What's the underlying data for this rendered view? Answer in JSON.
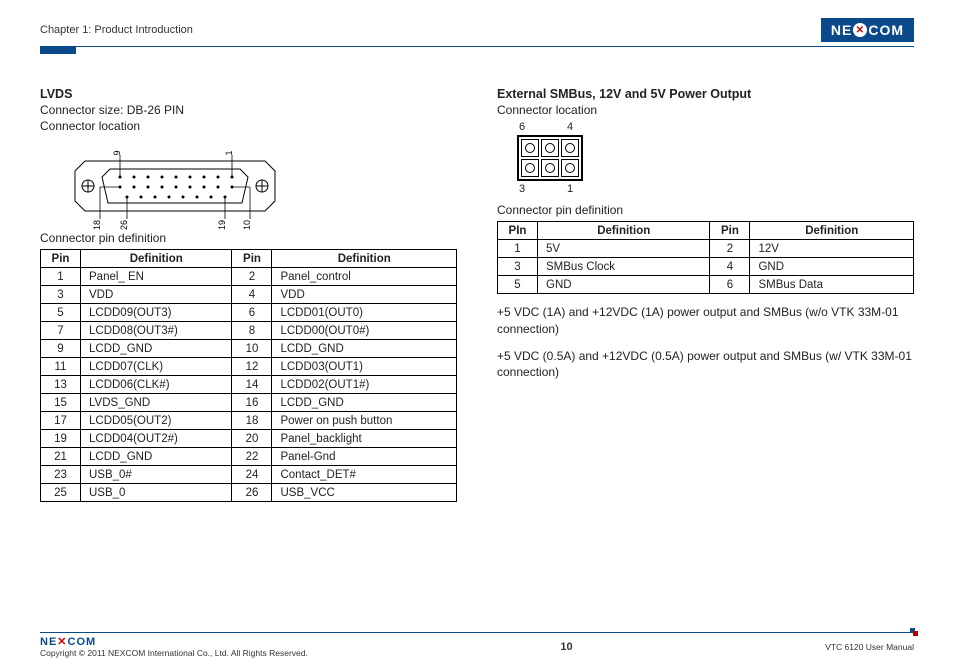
{
  "header": {
    "chapter": "Chapter 1: Product Introduction",
    "brand": "NEXCOM"
  },
  "left": {
    "title": "LVDS",
    "size": "Connector size: DB-26 PIN",
    "loc": "Connector location",
    "pin_caption": "Connector pin definition",
    "diagram_labels": {
      "top_left": "9",
      "top_right": "1",
      "mid_left": "18",
      "mid_right": "10",
      "bot_left": "26",
      "bot_right": "19"
    },
    "headers": [
      "Pin",
      "Definition",
      "Pin",
      "Definition"
    ],
    "rows": [
      [
        "1",
        "Panel_ EN",
        "2",
        "Panel_control"
      ],
      [
        "3",
        "VDD",
        "4",
        "VDD"
      ],
      [
        "5",
        "LCDD09(OUT3)",
        "6",
        "LCDD01(OUT0)"
      ],
      [
        "7",
        "LCDD08(OUT3#)",
        "8",
        "LCDD00(OUT0#)"
      ],
      [
        "9",
        "LCDD_GND",
        "10",
        "LCDD_GND"
      ],
      [
        "11",
        "LCDD07(CLK)",
        "12",
        "LCDD03(OUT1)"
      ],
      [
        "13",
        "LCDD06(CLK#)",
        "14",
        "LCDD02(OUT1#)"
      ],
      [
        "15",
        "LVDS_GND",
        "16",
        "LCDD_GND"
      ],
      [
        "17",
        "LCDD05(OUT2)",
        "18",
        "Power on push button"
      ],
      [
        "19",
        "LCDD04(OUT2#)",
        "20",
        "Panel_backlight"
      ],
      [
        "21",
        "LCDD_GND",
        "22",
        "Panel-Gnd"
      ],
      [
        "23",
        "USB_0#",
        "24",
        "Contact_DET#"
      ],
      [
        "25",
        "USB_0",
        "26",
        "USB_VCC"
      ]
    ]
  },
  "right": {
    "title": "External SMBus, 12V and 5V Power Output",
    "loc": "Connector location",
    "diagram_labels": {
      "tl": "6",
      "tr": "4",
      "bl": "3",
      "br": "1"
    },
    "pin_caption": "Connector pin definition",
    "headers": [
      "PIn",
      "Definition",
      "Pin",
      "Definition"
    ],
    "rows": [
      [
        "1",
        "5V",
        "2",
        "12V"
      ],
      [
        "3",
        "SMBus Clock",
        "4",
        "GND"
      ],
      [
        "5",
        "GND",
        "6",
        "SMBus Data"
      ]
    ],
    "note1": "+5 VDC (1A) and +12VDC (1A) power output and SMBus (w/o VTK 33M-01 connection)",
    "note2": "+5 VDC (0.5A) and +12VDC (0.5A) power output and SMBus (w/ VTK 33M-01 connection)"
  },
  "footer": {
    "brand": "NEXCOM",
    "copyright": "Copyright © 2011 NEXCOM International Co., Ltd. All Rights Reserved.",
    "page": "10",
    "doc": "VTC 6120 User Manual"
  }
}
